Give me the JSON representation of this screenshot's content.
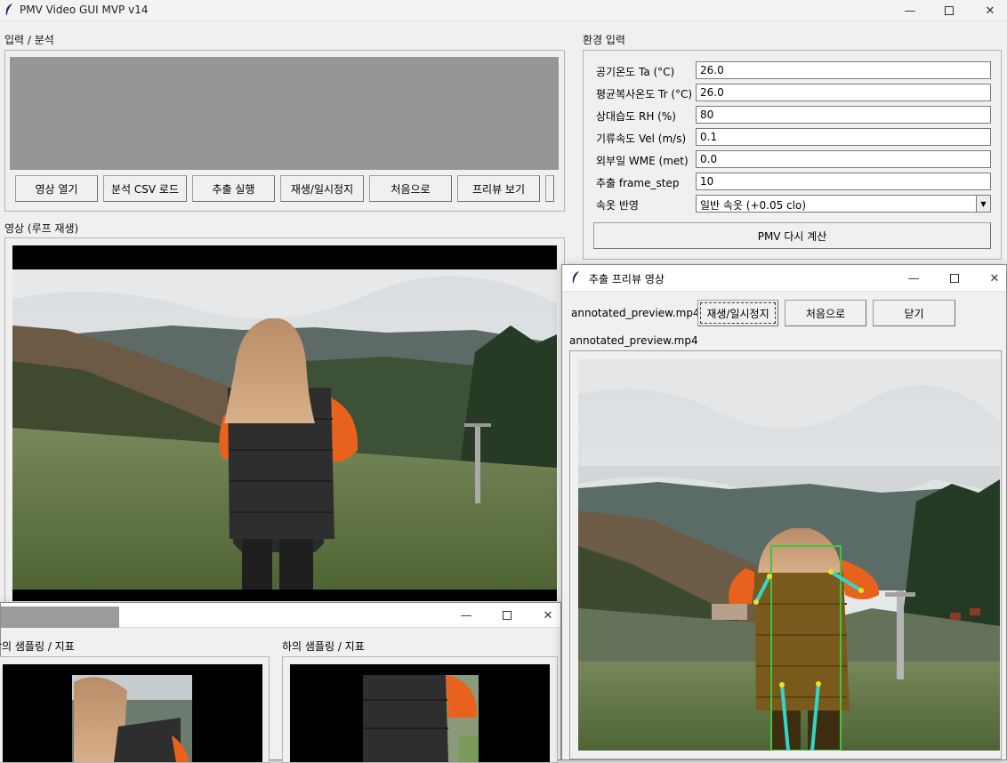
{
  "window": {
    "title": "PMV Video GUI MVP v14"
  },
  "input_section": {
    "label": "입력 / 분석",
    "buttons": [
      "영상 열기",
      "분석 CSV 로드",
      "추출 실행",
      "재생/일시정지",
      "처음으로",
      "프리뷰 보기"
    ]
  },
  "env_section": {
    "label": "환경 입력",
    "fields": [
      {
        "label": "공기온도 Ta (°C)",
        "value": "26.0"
      },
      {
        "label": "평균복사온도 Tr (°C)",
        "value": "26.0"
      },
      {
        "label": "상대습도 RH (%)",
        "value": "80"
      },
      {
        "label": "기류속도 Vel (m/s)",
        "value": "0.1"
      },
      {
        "label": "외부일 WME (met)",
        "value": "0.0"
      },
      {
        "label": "추출 frame_step",
        "value": "10"
      }
    ],
    "clothing": {
      "label": "속옷 반영",
      "value": "일반 속옷 (+0.05 clo)"
    },
    "recalc_button": "PMV 다시 계산"
  },
  "video_section": {
    "label": "영상 (루프 재생)"
  },
  "sampling_window": {
    "upper_label": "상의 샘플링 / 지표",
    "lower_label": "하의 샘플링 / 지표"
  },
  "preview_window": {
    "title": "추출 프리뷰 영상",
    "filename": "annotated_preview.mp4",
    "path_label": "annotated_preview.mp4",
    "play_button": "재생/일시정지",
    "restart_button": "처음으로",
    "close_button": "닫기"
  },
  "colors": {
    "skeleton": "#33d6c8",
    "bbox": "#3fc53f",
    "joint": "#f0e020"
  }
}
